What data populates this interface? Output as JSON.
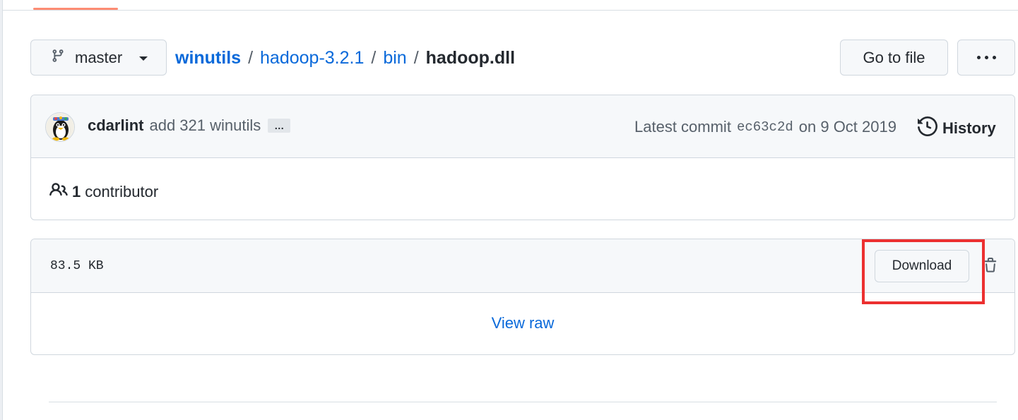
{
  "branch": {
    "name": "master"
  },
  "breadcrumb": {
    "repo": "winutils",
    "dir1": "hadoop-3.2.1",
    "dir2": "bin",
    "file": "hadoop.dll",
    "separator": "/"
  },
  "header_actions": {
    "go_to_file": "Go to file",
    "more_icon": "kebab-horizontal-icon"
  },
  "commit": {
    "author": "cdarlint",
    "message": "add 321 winutils",
    "ellipsis": "…",
    "latest_label": "Latest commit",
    "sha": "ec63c2d",
    "date_text": "on 9 Oct 2019",
    "history_label": "History"
  },
  "contributors": {
    "count": "1",
    "label": "contributor"
  },
  "file": {
    "size": "83.5 KB",
    "download_label": "Download",
    "view_raw_label": "View raw"
  },
  "colors": {
    "link": "#0969da",
    "highlight": "#ec3030",
    "tab_underline": "#fd8c73"
  }
}
